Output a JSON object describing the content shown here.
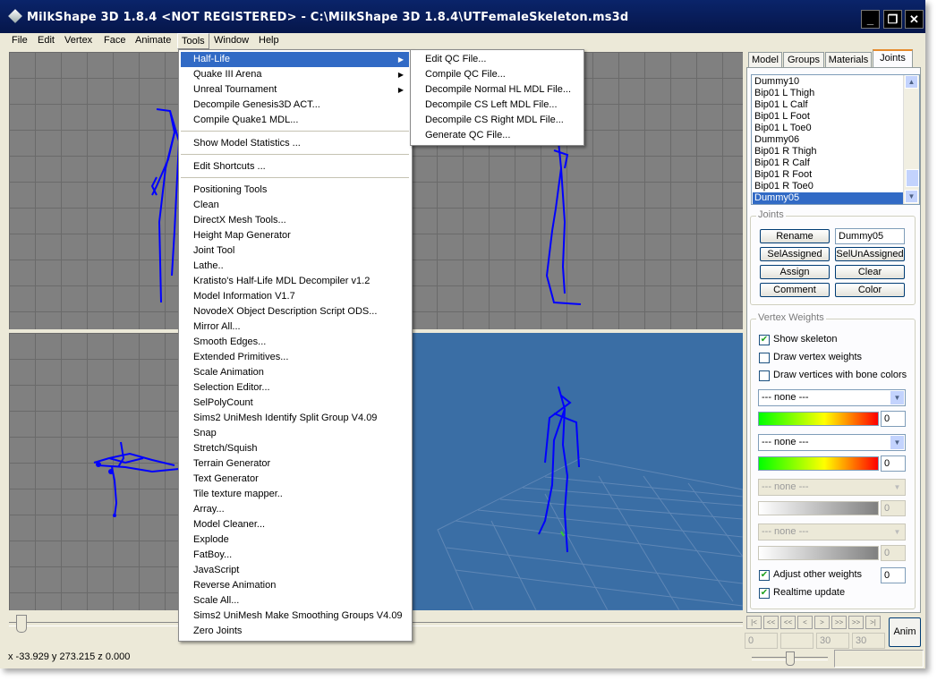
{
  "window": {
    "title": "MilkShape 3D 1.8.4 <NOT REGISTERED> - C:\\MilkShape 3D 1.8.4\\UTFemaleSkeleton.ms3d",
    "minimize": "_",
    "maximize": "❐",
    "close": "✕"
  },
  "menubar": [
    "File",
    "Edit",
    "Vertex",
    "Face",
    "Animate",
    "Tools",
    "Window",
    "Help"
  ],
  "tools_menu": {
    "items": [
      "Half-Life",
      "Quake III Arena",
      "Unreal Tournament",
      "Decompile Genesis3D ACT...",
      "Compile Quake1 MDL...",
      "Show Model Statistics ...",
      "Edit Shortcuts ...",
      "Positioning Tools",
      "Clean",
      "DirectX Mesh Tools...",
      "Height Map Generator",
      "Joint Tool",
      "Lathe..",
      "Kratisto's Half-Life MDL Decompiler v1.2",
      "Model Information V1.7",
      "NovodeX Object Description Script ODS...",
      "Mirror All...",
      "Smooth Edges...",
      "Extended Primitives...",
      "Scale Animation",
      "Selection Editor...",
      "SelPolyCount",
      "Sims2 UniMesh Identify Split Group V4.09",
      "Snap",
      "Stretch/Squish",
      "Terrain Generator",
      "Text Generator",
      "Tile texture mapper..",
      "Array...",
      "Model Cleaner...",
      "Explode",
      "FatBoy...",
      "JavaScript",
      "Reverse Animation",
      "Scale All...",
      "Sims2 UniMesh Make Smoothing Groups V4.09",
      "Zero Joints"
    ]
  },
  "halflife_submenu": {
    "items": [
      "Edit QC File...",
      "Compile QC File...",
      "Decompile Normal HL MDL File...",
      "Decompile CS Left MDL File...",
      "Decompile CS Right MDL File...",
      "Generate QC File..."
    ]
  },
  "tabs": [
    "Model",
    "Groups",
    "Materials",
    "Joints"
  ],
  "joint_list": [
    "Dummy10",
    "Bip01 L Thigh",
    "Bip01 L Calf",
    "Bip01 L Foot",
    "Bip01 L Toe0",
    "Dummy06",
    "Bip01 R Thigh",
    "Bip01 R Calf",
    "Bip01 R Foot",
    "Bip01 R Toe0",
    "Dummy05"
  ],
  "joints_group": {
    "label": "Joints",
    "rename": "Rename",
    "name_value": "Dummy05",
    "sel_assigned": "SelAssigned",
    "sel_unassigned": "SelUnAssigned",
    "assign": "Assign",
    "clear": "Clear",
    "comment": "Comment",
    "color": "Color"
  },
  "vertex_weights": {
    "label": "Vertex Weights",
    "show_skeleton": "Show skeleton",
    "draw_vertex_weights": "Draw vertex weights",
    "draw_vertices_bone_colors": "Draw vertices with bone colors",
    "combo_none": "--- none ---",
    "weight_values": [
      "0",
      "0",
      "0",
      "0"
    ],
    "adjust_other_weights": "Adjust other weights",
    "adjust_value": "0",
    "realtime_update": "Realtime update"
  },
  "animation": {
    "frame_start": "0",
    "frame_end": "30",
    "frame_total": "30",
    "anim_button": "Anim",
    "nav_buttons": [
      "|<",
      "<<",
      "<",
      ">",
      ">>",
      ">|"
    ]
  },
  "status": {
    "coords": "x -33.929 y 273.215 z 0.000"
  },
  "colors": {
    "title_bar": "#0a246a",
    "viewport_gray": "#808080",
    "viewport_3d": "#3a6ea5",
    "skeleton": "#0000ff",
    "menu_highlight": "#316ac5"
  }
}
